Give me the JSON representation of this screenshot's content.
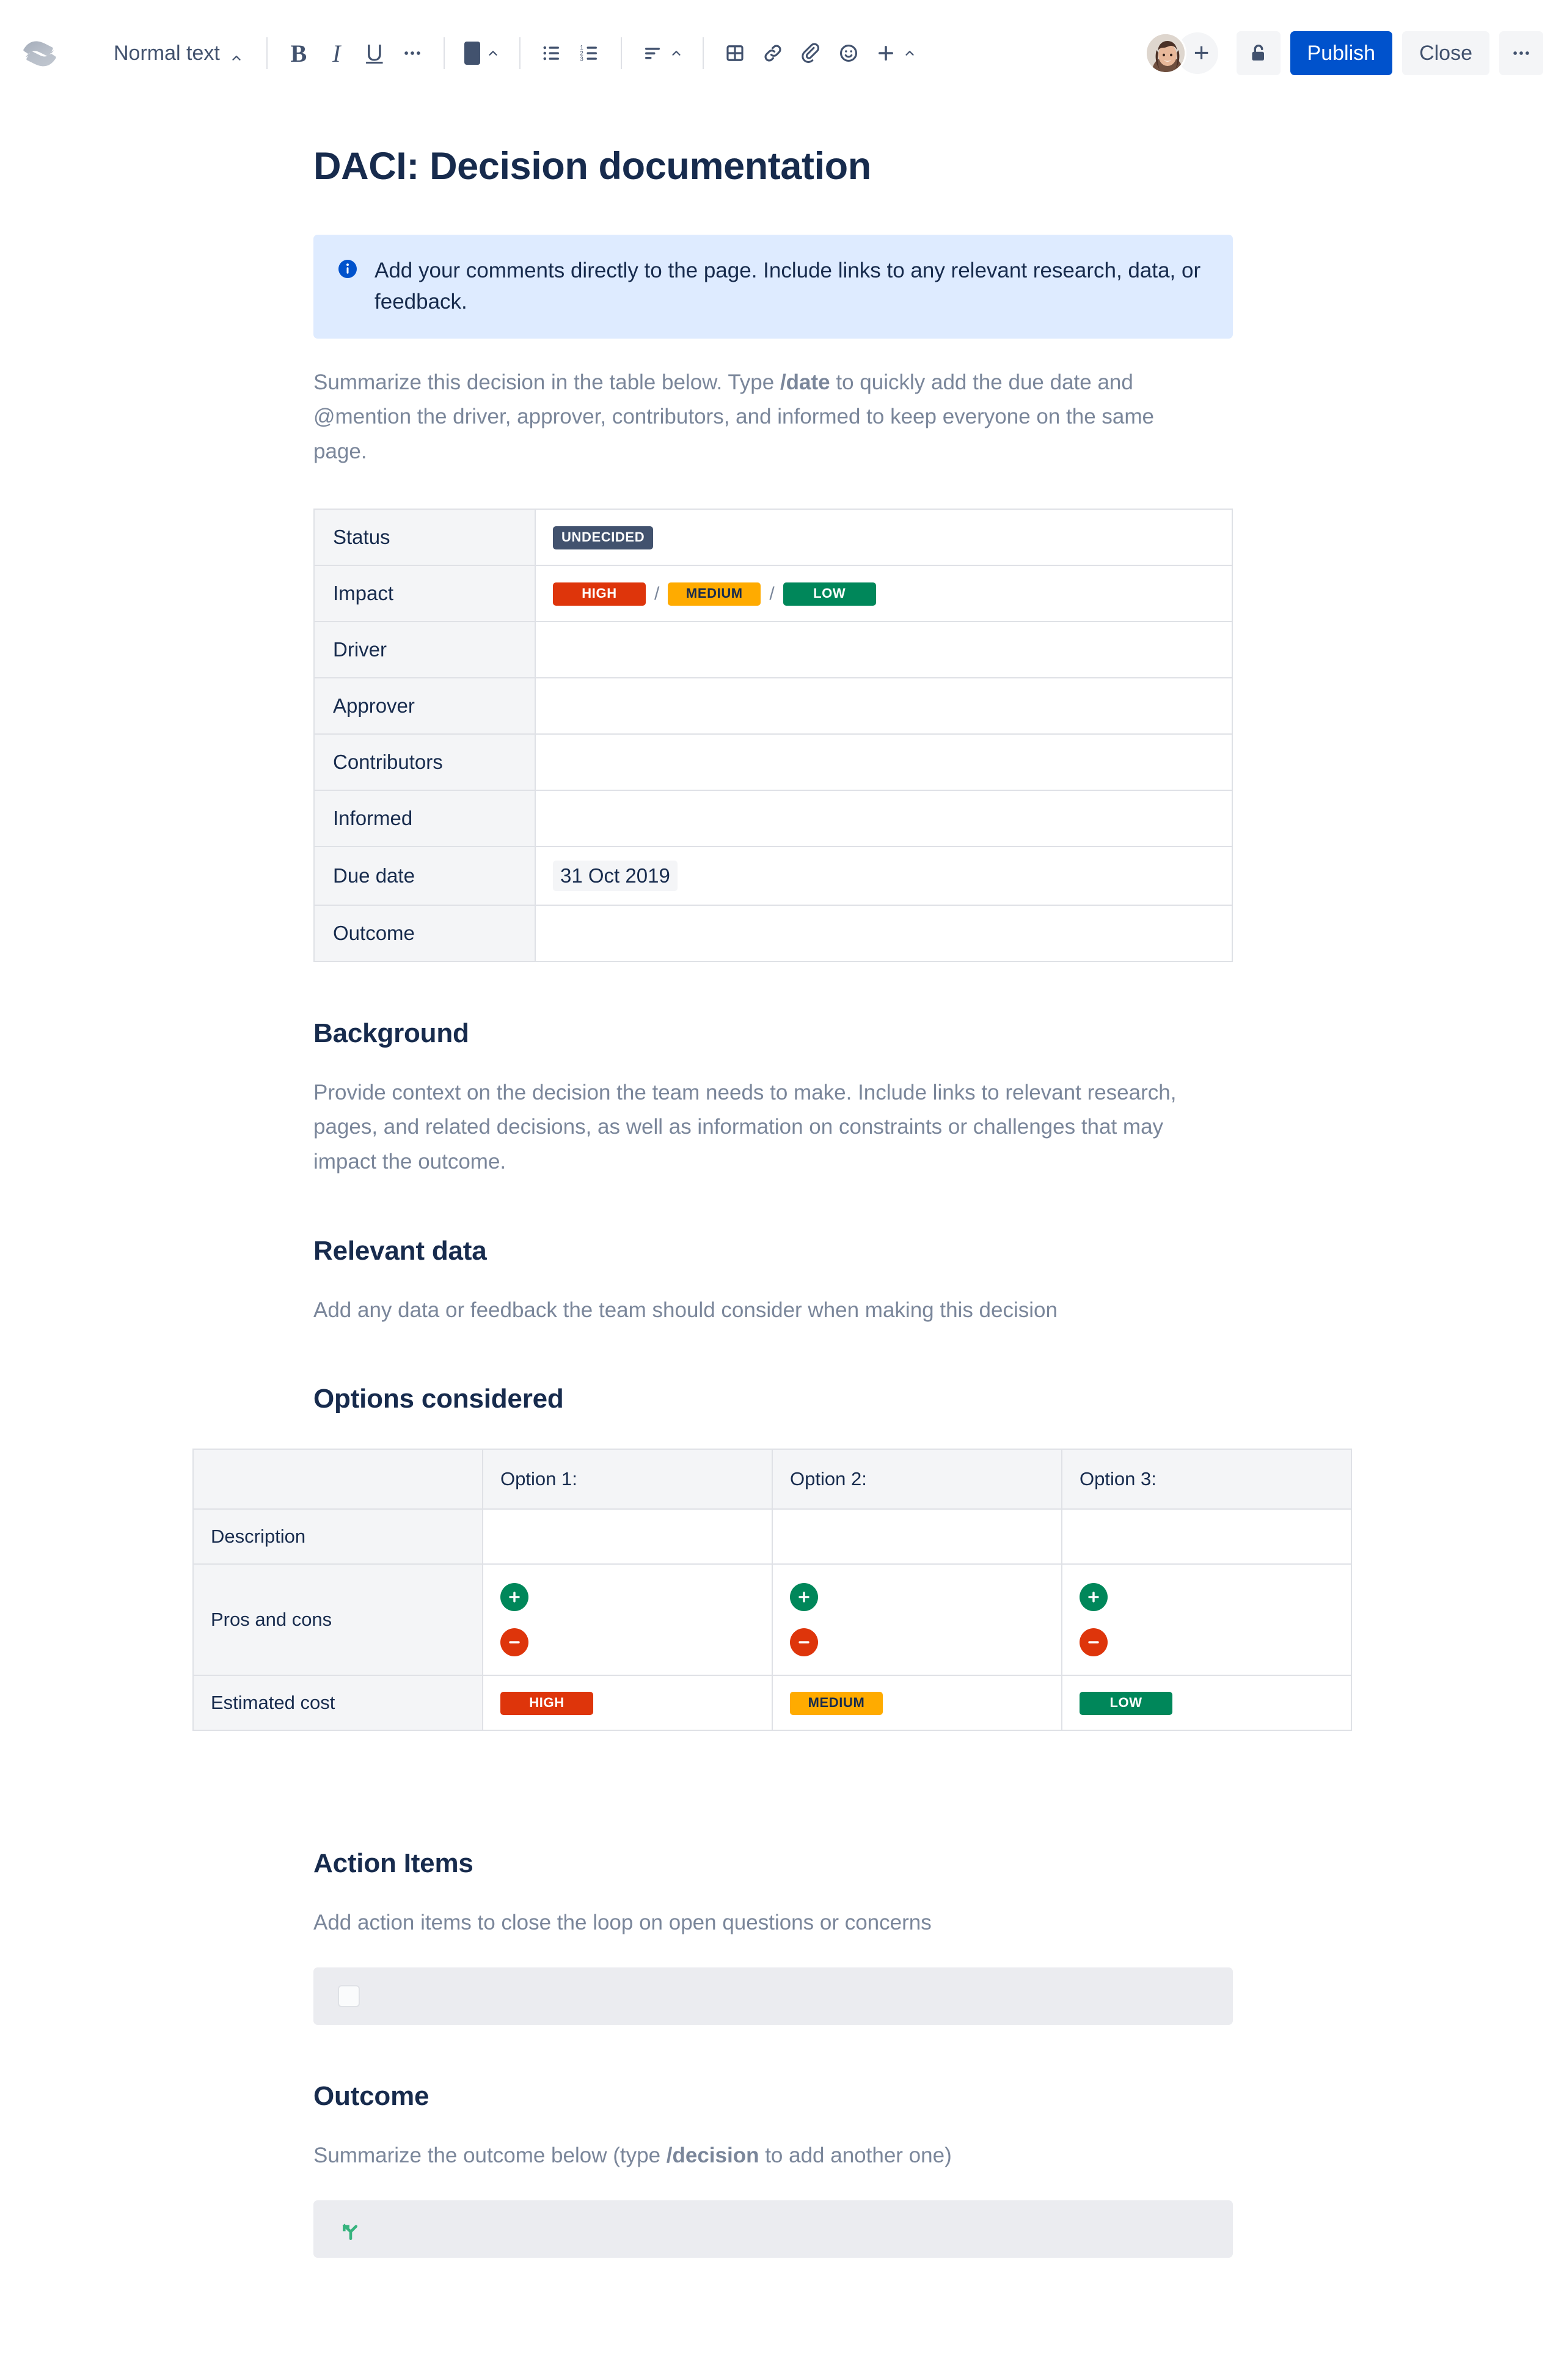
{
  "toolbar": {
    "logo_icon": "confluence-logo",
    "text_style": {
      "label": "Normal text",
      "chevron_icon": "chevron-up-icon"
    },
    "bold_label": "B",
    "italic_label": "I",
    "underline_label": "U",
    "more_formatting_label": "•••",
    "text_color_icon": "text-color-swatch",
    "bullet_list_icon": "bullet-list-icon",
    "numbered_list_icon": "numbered-list-icon",
    "align_icon": "text-align-icon",
    "table_icon": "table-icon",
    "link_icon": "link-icon",
    "attachment_icon": "paperclip-icon",
    "emoji_icon": "emoji-icon",
    "insert_label": "+",
    "avatar_icon": "user-avatar",
    "add_collaborator_label": "+",
    "restrictions_icon": "unlock-icon",
    "publish_label": "Publish",
    "close_label": "Close",
    "more_actions_label": "•••"
  },
  "document": {
    "title": "DACI: Decision documentation",
    "info_panel": {
      "icon": "info-icon",
      "text": "Add your comments directly to the page. Include links to any relevant research, data, or feedback."
    },
    "intro": {
      "before": "Summarize this decision in the table below. Type ",
      "bold": "/date",
      "after": " to quickly add the due date and @mention the driver, approver, contributors, and informed to keep everyone on the same page."
    },
    "daci_table": {
      "rows": [
        {
          "label": "Status",
          "type": "status"
        },
        {
          "label": "Impact",
          "type": "impact"
        },
        {
          "label": "Driver",
          "type": "empty"
        },
        {
          "label": "Approver",
          "type": "empty"
        },
        {
          "label": "Contributors",
          "type": "empty"
        },
        {
          "label": "Informed",
          "type": "empty"
        },
        {
          "label": "Due date",
          "type": "date"
        },
        {
          "label": "Outcome",
          "type": "empty"
        }
      ],
      "status_badge": "UNDECIDED",
      "impact_high": "HIGH",
      "impact_medium": "MEDIUM",
      "impact_low": "LOW",
      "impact_separator": "/",
      "due_date": "31 Oct 2019"
    },
    "background": {
      "heading": "Background",
      "text": "Provide context on the decision the team needs to make. Include links to relevant research, pages, and related decisions, as well as information on constraints or challenges that may impact the outcome."
    },
    "relevant_data": {
      "heading": "Relevant data",
      "text": "Add any data or feedback the team should consider when making this decision"
    },
    "options": {
      "heading": "Options considered",
      "corner": "",
      "columns": [
        "Option 1:",
        "Option 2:",
        "Option 3:"
      ],
      "row_labels": [
        "Description",
        "Pros and cons",
        "Estimated cost"
      ],
      "description_cells": [
        "",
        "",
        ""
      ],
      "pros_icon": "plus-circle-icon",
      "cons_icon": "minus-circle-icon",
      "estimated_cost": [
        "HIGH",
        "MEDIUM",
        "LOW"
      ]
    },
    "action_items": {
      "heading": "Action Items",
      "text": "Add action items to close the loop on open questions or concerns",
      "task_checkbox_icon": "task-checkbox",
      "task_text": ""
    },
    "outcome": {
      "heading": "Outcome",
      "before": "Summarize the outcome below (type ",
      "bold": "/decision",
      "after": " to add another one)",
      "decision_icon": "decision-fork-icon",
      "decision_text": ""
    }
  },
  "colors": {
    "primary": "#0052cc",
    "high": "#de350b",
    "medium": "#ffab00",
    "low": "#00875a",
    "undecided": "#42526e",
    "info_panel_bg": "#deebff",
    "grey_panel_bg": "#ebecf0",
    "decision_green": "#36b37e"
  }
}
